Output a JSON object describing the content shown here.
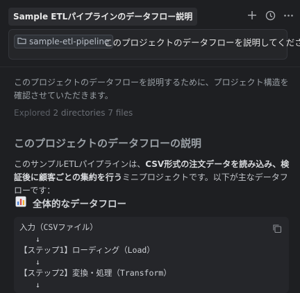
{
  "header": {
    "title": "Sample ETLパイプラインのデータフロー説明",
    "icons": [
      "plus-icon",
      "history-icon",
      "more-icon"
    ]
  },
  "prompt": {
    "repo_chip": "sample-etl-pipeline",
    "text": "このプロジェクトのデータフローを説明してください"
  },
  "response": {
    "intro": "このプロジェクトのデータフローを説明するために、プロジェクト構造を確認させていただきます。",
    "explored": {
      "label": "Explored",
      "detail": "2 directories 7 files"
    },
    "heading": "このプロジェクトのデータフローの説明",
    "paragraph": {
      "part1": "このサンプルETLパイプラインは、",
      "bold1": "CSV形式の注文データを読み込み、検証後に顧客ごとの集約を行う",
      "part2": "ミニプロジェクトです。以下が主なデータフローです："
    },
    "section_heading": "全体的なデータフロー",
    "code_lines": [
      "入力（CSVファイル）",
      "　　↓",
      "【ステップ1】ローディング（Load）",
      "　　↓",
      "【ステップ2】変換・処理（Transform）",
      "　　↓"
    ]
  }
}
